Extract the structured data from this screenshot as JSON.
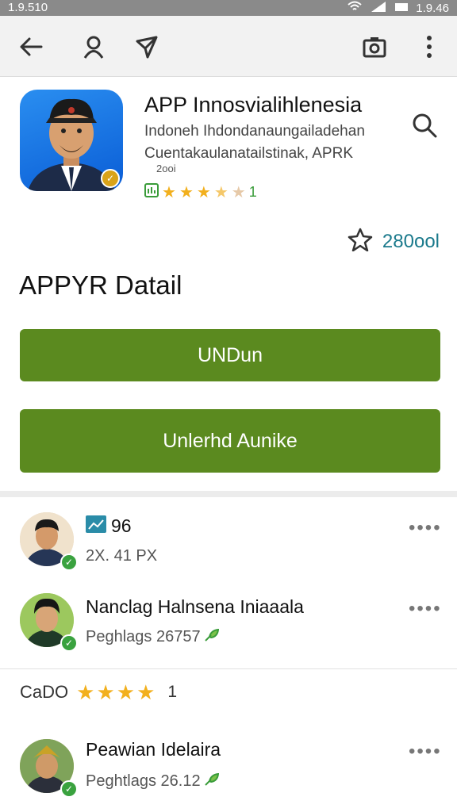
{
  "status_bar": {
    "left_time": "1.9.510",
    "right_time": "1.9.46"
  },
  "toolbar": {
    "back_icon": "arrow-left-icon",
    "profile_icon": "person-icon",
    "share_icon": "send-icon",
    "camera_icon": "camera-icon",
    "menu_icon": "more-vert-icon"
  },
  "app": {
    "title": "APP Innosvialihlenesia",
    "subtitle_1": "Indoneh Ihdondanaungailadehan",
    "subtitle_2": "Cuentakaulanatailstinak, APRK",
    "subtitle_3": "2ooi",
    "rating_suffix": "1",
    "wishlist_count": "280ool",
    "accent": "#5b8a1f"
  },
  "detail": {
    "heading": "APPYR Datail",
    "primary_button": "UNDun",
    "secondary_button": "Unlerhd Aunike"
  },
  "reviews": [
    {
      "name": "96",
      "meta": "2X. 41 PX",
      "more": "••••"
    },
    {
      "name": "Nanclag Halnsena Iniaaala",
      "meta": "Peghlags 26757",
      "more": "••••"
    },
    {
      "name": "Peawian Idelaira",
      "meta": "Peghtlags 26.12",
      "more": "••••"
    }
  ],
  "mid_rating": {
    "label": "CaDO",
    "count": "1"
  }
}
